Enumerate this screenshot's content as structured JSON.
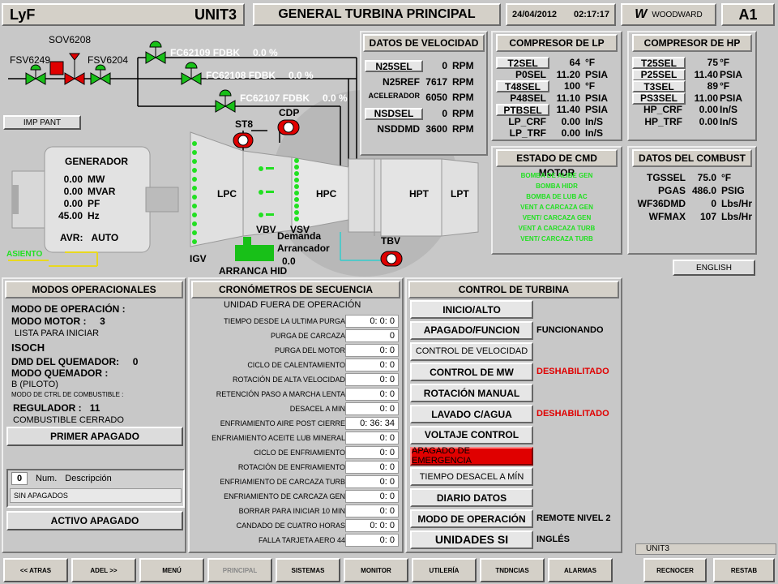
{
  "header": {
    "site": "LyF",
    "unit": "UNIT3",
    "title": "GENERAL TURBINA PRINCIPAL",
    "date": "24/04/2012",
    "time": "02:17:17",
    "brand": "WOODWARD",
    "screen_id": "A1"
  },
  "imp_pant": "IMP PANT",
  "valves": {
    "sov": "SOV6208",
    "fsv1": "FSV6249",
    "fsv2": "FSV6204",
    "fc1": "FC62109 FDBK",
    "fc1_val": "0.0 %",
    "fc2": "FC62108 FDBK",
    "fc2_val": "0.0 %",
    "fc3": "FC62107 FDBK",
    "fc3_val": "0.0 %",
    "st8": "ST8",
    "cdp": "CDP",
    "tbv": "TBV"
  },
  "generator": {
    "title": "GENERADOR",
    "rows": [
      {
        "v": "0.00",
        "u": "MW"
      },
      {
        "v": "0.00",
        "u": "MVAR"
      },
      {
        "v": "0.00",
        "u": "PF"
      },
      {
        "v": "45.00",
        "u": "Hz"
      }
    ],
    "avr_label": "AVR:",
    "avr_val": "AUTO",
    "asiento": "ASIENTO"
  },
  "turbine": {
    "lpc": "LPC",
    "hpc": "HPC",
    "hpt": "HPT",
    "lpt": "LPT",
    "vbv": "VBV",
    "vsv": "VSV",
    "igv": "IGV",
    "demanda": "Demanda",
    "arrancador": "Arrancador",
    "demanda_val": "0.0",
    "arranca": "ARRANCA HID"
  },
  "velocidad": {
    "title": "DATOS DE VELOCIDAD",
    "rows": [
      {
        "l": "N25SEL",
        "v": "0",
        "u": "RPM",
        "btn": true
      },
      {
        "l": "N25REF",
        "v": "7617",
        "u": "RPM",
        "btn": false
      },
      {
        "l": "ACELERADOR",
        "v": "6050",
        "u": "RPM",
        "btn": false
      },
      {
        "l": "NSDSEL",
        "v": "0",
        "u": "RPM",
        "btn": true
      },
      {
        "l": "NSDDMD",
        "v": "3600",
        "u": "RPM",
        "btn": false
      }
    ]
  },
  "comp_lp": {
    "title": "COMPRESOR DE LP",
    "rows": [
      {
        "l": "T2SEL",
        "v": "64",
        "u": "°F",
        "btn": true
      },
      {
        "l": "P0SEL",
        "v": "11.20",
        "u": "PSIA",
        "btn": false
      },
      {
        "l": "T48SEL",
        "v": "100",
        "u": "°F",
        "btn": true
      },
      {
        "l": "P48SEL",
        "v": "11.10",
        "u": "PSIA",
        "btn": false
      },
      {
        "l": "PTBSEL",
        "v": "11.40",
        "u": "PSIA",
        "btn": true
      },
      {
        "l": "LP_CRF",
        "v": "0.00",
        "u": "In/S",
        "btn": false
      },
      {
        "l": "LP_TRF",
        "v": "0.00",
        "u": "In/S",
        "btn": false
      }
    ]
  },
  "comp_hp": {
    "title": "COMPRESOR DE HP",
    "rows": [
      {
        "l": "T25SEL",
        "v": "75",
        "u": "°F",
        "btn": true
      },
      {
        "l": "P25SEL",
        "v": "11.40",
        "u": "PSIA",
        "btn": true
      },
      {
        "l": "T3SEL",
        "v": "89",
        "u": "°F",
        "btn": true
      },
      {
        "l": "PS3SEL",
        "v": "11.00",
        "u": "PSIA",
        "btn": true
      },
      {
        "l": "HP_CRF",
        "v": "0.00",
        "u": "In/S",
        "btn": false
      },
      {
        "l": "HP_TRF",
        "v": "0.00",
        "u": "In/S",
        "btn": false
      }
    ]
  },
  "estado_cmd": {
    "title": "ESTADO DE CMD MOTOR",
    "items": [
      "BOMBA DE ALIBE GEN",
      "BOMBA HIDR",
      "BOMBA DE LUB AC",
      "VENT A CARCAZA GEN",
      "VENT/ CARCAZA GEN",
      "VENT A CARCAZA TURB",
      "VENT/ CARCAZA TURB"
    ]
  },
  "combust": {
    "title": "DATOS DEL COMBUST",
    "rows": [
      {
        "l": "TGSSEL",
        "v": "75.0",
        "u": "°F"
      },
      {
        "l": "PGAS",
        "v": "486.0",
        "u": "PSIG"
      },
      {
        "l": "WF36DMD",
        "v": "0",
        "u": "Lbs/Hr"
      },
      {
        "l": "WFMAX",
        "v": "107",
        "u": "Lbs/Hr"
      }
    ]
  },
  "english": "ENGLISH",
  "modos": {
    "title": "MODOS OPERACIONALES",
    "modo_op": "MODO DE OPERACIÓN :",
    "modo_motor": "MODO MOTOR :",
    "modo_motor_val": "3",
    "lista": "LISTA PARA INICIAR",
    "isoch": "ISOCH",
    "dmd": "DMD DEL QUEMADOR:",
    "dmd_val": "0",
    "modo_q": "MODO QUEMADOR :",
    "piloto": "B (PILOTO)",
    "ctrl_comb": "MODO DE CTRL DE COMBUSTIBLE :",
    "regulador": "REGULADOR :",
    "regulador_val": "11",
    "comb_cerrado": "COMBUSTIBLE CERRADO",
    "primer": "PRIMER APAGADO",
    "num": "0",
    "num_lbl": "Num.",
    "desc_lbl": "Descripción",
    "sin": "SIN APAGADOS",
    "activo": "ACTIVO APAGADO"
  },
  "crono": {
    "title": "CRONÓMETROS DE SECUENCIA",
    "subtitle": "UNIDAD FUERA DE OPERACIÓN",
    "rows": [
      {
        "l": "TIEMPO DESDE LA ULTIMA PURGA",
        "v": "0:  0:  0"
      },
      {
        "l": "PURGA DE CARCAZA",
        "v": "0"
      },
      {
        "l": "PURGA DEL MOTOR",
        "v": "0:  0"
      },
      {
        "l": "CICLO DE CALENTAMIENTO",
        "v": "0:  0"
      },
      {
        "l": "ROTACIÓN DE ALTA VELOCIDAD",
        "v": "0:  0"
      },
      {
        "l": "RETENCIÓN PASO A MARCHA LENTA",
        "v": "0:  0"
      },
      {
        "l": "DESACEL A MIN",
        "v": "0:  0"
      },
      {
        "l": "ENFRIAMIENTO AIRE POST CIERRE",
        "v": "0: 36: 34"
      },
      {
        "l": "ENFRIAMIENTO ACEITE LUB MINERAL",
        "v": "0:  0"
      },
      {
        "l": "CICLO DE ENFRIAMIENTO",
        "v": "0:  0"
      },
      {
        "l": "ROTACIÓN DE ENFRIAMIENTO",
        "v": "0:  0"
      },
      {
        "l": "ENFRIAMIENTO DE CARCAZA TURB",
        "v": "0:  0"
      },
      {
        "l": "ENFRIAMIENTO DE CARCAZA GEN",
        "v": "0:  0"
      },
      {
        "l": "BORRAR PARA INICIAR 10 MIN",
        "v": "0:  0"
      },
      {
        "l": "CANDADO DE CUATRO HORAS",
        "v": "0:  0:  0"
      },
      {
        "l": "FALLA TARJETA AERO 44",
        "v": "0:  0"
      }
    ]
  },
  "control": {
    "title": "CONTROL DE TURBINA",
    "buttons": [
      {
        "l": "INICIO/ALTO",
        "s": ""
      },
      {
        "l": "APAGADO/FUNCION",
        "s": "FUNCIONANDO"
      },
      {
        "l": "CONTROL DE VELOCIDAD",
        "s": ""
      },
      {
        "l": "CONTROL DE MW",
        "s": "DESHABILITADO"
      },
      {
        "l": "ROTACIÓN MANUAL",
        "s": ""
      },
      {
        "l": "LAVADO C/AGUA",
        "s": "DESHABILITADO"
      },
      {
        "l": "VOLTAJE CONTROL",
        "s": ""
      },
      {
        "l": "APAGADO DE EMERGENCIA",
        "s": ""
      },
      {
        "l": "TIEMPO DESACEL A MÍN",
        "s": ""
      },
      {
        "l": "DIARIO DATOS",
        "s": ""
      },
      {
        "l": "MODO DE OPERACIÓN",
        "s": "REMOTE NIVEL 2"
      },
      {
        "l": "UNIDADES SI",
        "s": "INGLÉS"
      }
    ]
  },
  "footer": {
    "unit": "UNIT3",
    "nav": [
      "<< ATRAS",
      "ADEL >>",
      "MENÚ",
      "PRINCIPAL",
      "SISTEMAS",
      "MONITOR",
      "UTILERÍA",
      "TNDNCIAS",
      "ALARMAS"
    ],
    "reconocer": "RECNOCER",
    "restab": "RESTAB"
  },
  "colors": {
    "alarm_red": "#e00000",
    "status_green": "#22e022",
    "valve_green": "#18c018",
    "bg": "#c8c8c8"
  }
}
